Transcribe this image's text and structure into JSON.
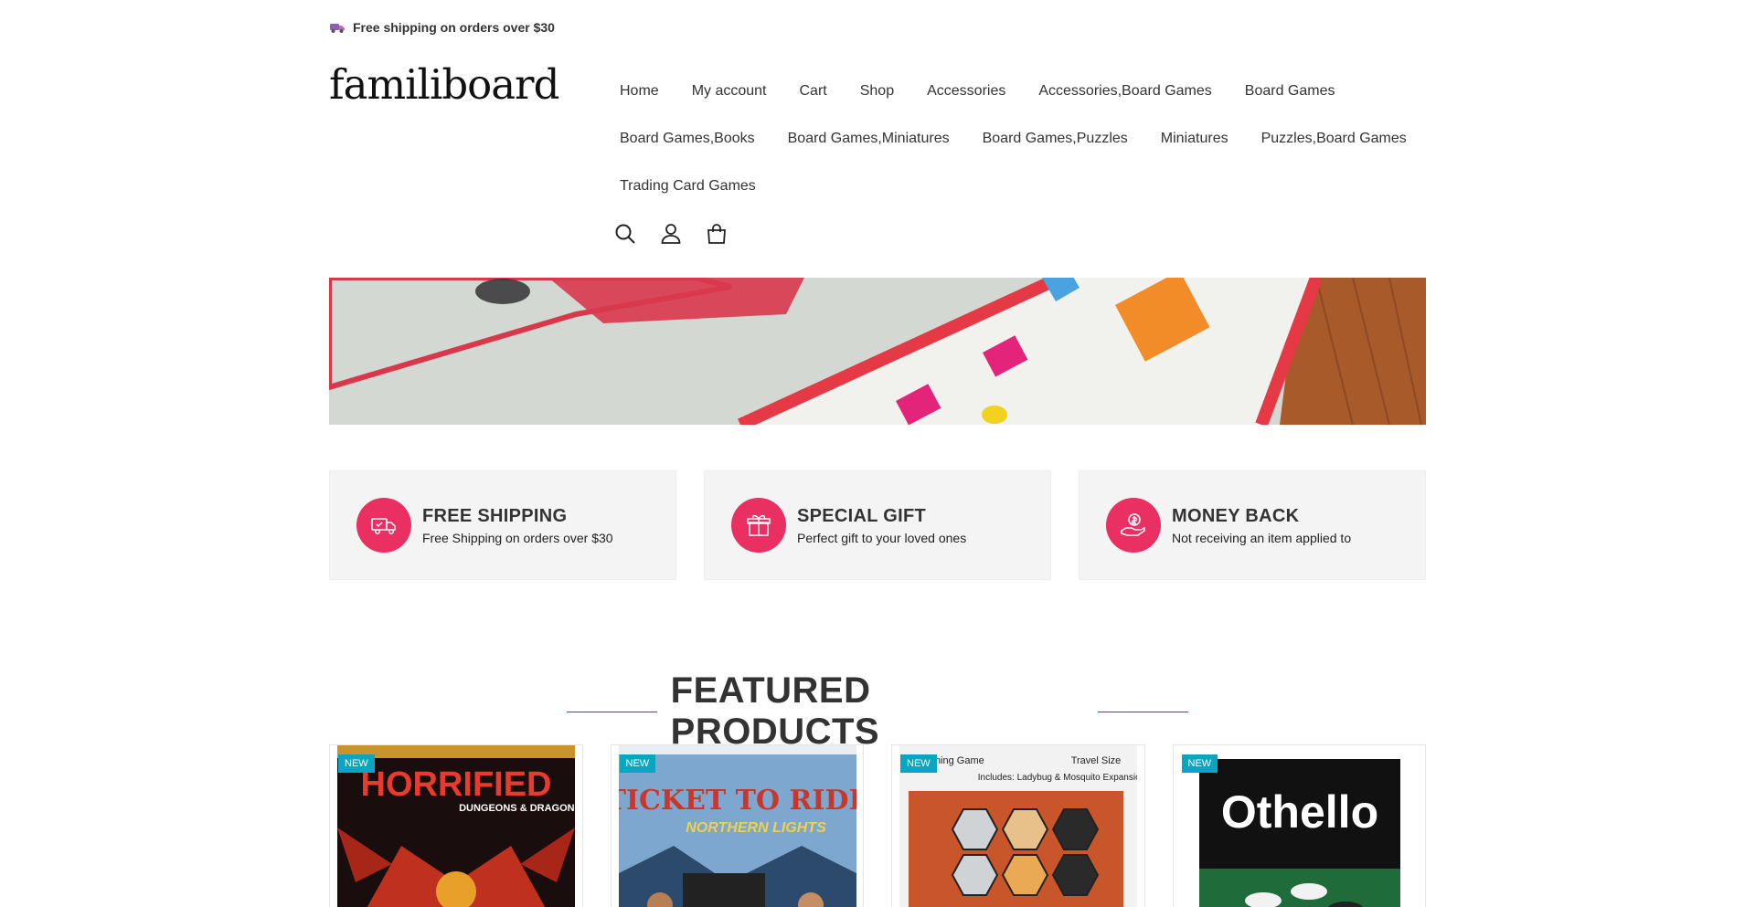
{
  "topbar": {
    "text": "Free shipping on orders over $30"
  },
  "brand": {
    "logo": "familiboard"
  },
  "nav": {
    "rows": [
      [
        "Home",
        "My account",
        "Cart",
        "Shop",
        "Accessories",
        "Accessories,Board Games",
        "Board Games"
      ],
      [
        "Board Games,Books",
        "Board Games,Miniatures",
        "Board Games,Puzzles",
        "Miniatures",
        "Puzzles,Board Games"
      ],
      [
        "Trading Card Games"
      ]
    ],
    "icons": [
      "search-icon",
      "user-icon",
      "bag-icon"
    ]
  },
  "features": [
    {
      "title": "FREE SHIPPING",
      "subtitle": "Free Shipping on orders over $30",
      "icon": "truck-icon"
    },
    {
      "title": "SPECIAL GIFT",
      "subtitle": "Perfect gift to your loved ones",
      "icon": "gift-icon"
    },
    {
      "title": "MONEY BACK",
      "subtitle": "Not receiving an item applied to",
      "icon": "money-hand-icon"
    }
  ],
  "section": {
    "title": "FEATURED PRODUCTS"
  },
  "products": [
    {
      "badge": "NEW",
      "image_title": "HORRIFIED",
      "image_subtitle": "DUNGEONS & DRAGONS"
    },
    {
      "badge": "NEW",
      "image_title": "TICKET TO RIDE",
      "image_subtitle": "NORTHERN LIGHTS"
    },
    {
      "badge": "NEW",
      "image_title": "",
      "image_subtitle": "Travel Size",
      "image_caption": "Includes: Ladybug & Mosquito Expansions",
      "image_top": "Winning Game"
    },
    {
      "badge": "NEW",
      "image_title": "Othello",
      "image_subtitle": ""
    }
  ],
  "colors": {
    "accent": "#ea2f63",
    "badge": "#0aa5c0",
    "title_line": "#c2185b"
  }
}
